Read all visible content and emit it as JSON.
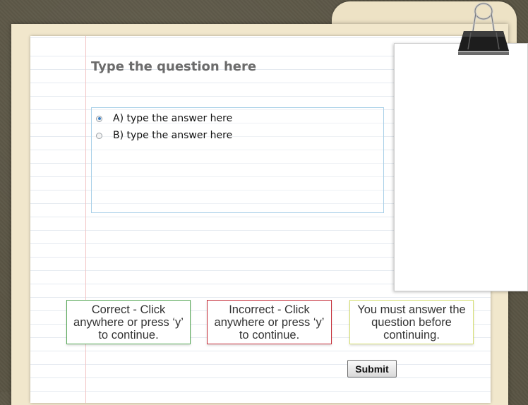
{
  "quiz": {
    "question": "Type the question here",
    "answers": [
      {
        "label": "A) type the answer here",
        "selected": true
      },
      {
        "label": "B) type the answer here",
        "selected": false
      }
    ],
    "submit_label": "Submit"
  },
  "feedback": {
    "correct": "Correct - Click anywhere or press ‘y’ to continue.",
    "incorrect": "Incorrect - Click anywhere or press ‘y’ to continue.",
    "incomplete": "You must answer the question before continuing."
  },
  "colors": {
    "correct_border": "#57a857",
    "incorrect_border": "#c62f3a",
    "incomplete_border": "#d6df73",
    "answers_border": "#a9d0e8",
    "radio_selected": "#3b7fc4"
  },
  "icons": {
    "clip": "binder-clip-icon",
    "radio_selected": "radio-selected-icon",
    "radio_unselected": "radio-unselected-icon"
  }
}
